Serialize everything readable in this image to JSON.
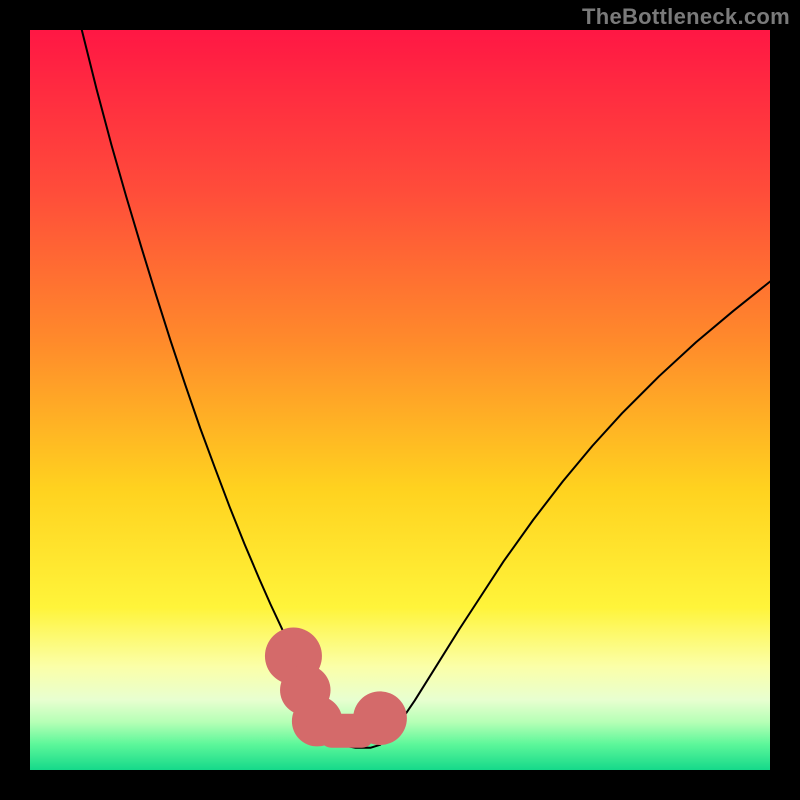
{
  "watermark": "TheBottleneck.com",
  "chart_data": {
    "type": "line",
    "title": "",
    "xlabel": "",
    "ylabel": "",
    "xlim": [
      0,
      100
    ],
    "ylim": [
      0,
      100
    ],
    "background": {
      "type": "vertical-gradient",
      "stops": [
        {
          "t": 0.0,
          "color": "#ff1744"
        },
        {
          "t": 0.22,
          "color": "#ff4d3a"
        },
        {
          "t": 0.42,
          "color": "#ff8a2b"
        },
        {
          "t": 0.62,
          "color": "#ffd21f"
        },
        {
          "t": 0.78,
          "color": "#fff43a"
        },
        {
          "t": 0.86,
          "color": "#fbffa8"
        },
        {
          "t": 0.905,
          "color": "#e8ffd0"
        },
        {
          "t": 0.935,
          "color": "#b6ffb6"
        },
        {
          "t": 0.965,
          "color": "#5df79a"
        },
        {
          "t": 1.0,
          "color": "#15d98a"
        }
      ]
    },
    "series": [
      {
        "name": "bottleneck-curve",
        "stroke": "#000000",
        "stroke_width": 2.0,
        "x": [
          7.0,
          9.0,
          11.0,
          13.0,
          15.0,
          17.0,
          19.0,
          21.0,
          23.0,
          25.0,
          27.0,
          29.0,
          31.0,
          32.5,
          34.0,
          35.3,
          36.5,
          38.0,
          40.0,
          42.0,
          44.0,
          46.0,
          47.3,
          49.0,
          52.0,
          55.0,
          58.0,
          61.0,
          64.0,
          68.0,
          72.0,
          76.0,
          80.0,
          85.0,
          90.0,
          95.0,
          100.0
        ],
        "y": [
          100.0,
          92.0,
          84.5,
          77.5,
          70.8,
          64.3,
          58.0,
          52.0,
          46.2,
          40.8,
          35.5,
          30.5,
          25.8,
          22.4,
          19.2,
          16.2,
          13.2,
          9.0,
          5.2,
          3.4,
          3.0,
          3.0,
          3.4,
          5.0,
          9.4,
          14.2,
          19.0,
          23.6,
          28.2,
          33.8,
          39.0,
          43.8,
          48.2,
          53.2,
          57.8,
          62.0,
          66.0
        ]
      }
    ],
    "markers": [
      {
        "shape": "circle",
        "color": "#d46a6a",
        "r": 7.0,
        "cx": 35.6,
        "cy": 15.4
      },
      {
        "shape": "circle",
        "color": "#d46a6a",
        "r": 6.2,
        "cx": 37.2,
        "cy": 10.8
      },
      {
        "shape": "circle",
        "color": "#d46a6a",
        "r": 6.2,
        "cx": 38.8,
        "cy": 6.6
      },
      {
        "shape": "circle",
        "color": "#d46a6a",
        "r": 6.6,
        "cx": 47.3,
        "cy": 7.0
      },
      {
        "shape": "bar",
        "color": "#d46a6a",
        "x": 39.2,
        "y": 3.0,
        "w": 7.2,
        "h": 4.6,
        "rx": 2.2
      }
    ]
  },
  "colors": {
    "frame": "#000000",
    "curve": "#000000",
    "marker": "#d46a6a",
    "watermark": "#7a7a7a"
  }
}
